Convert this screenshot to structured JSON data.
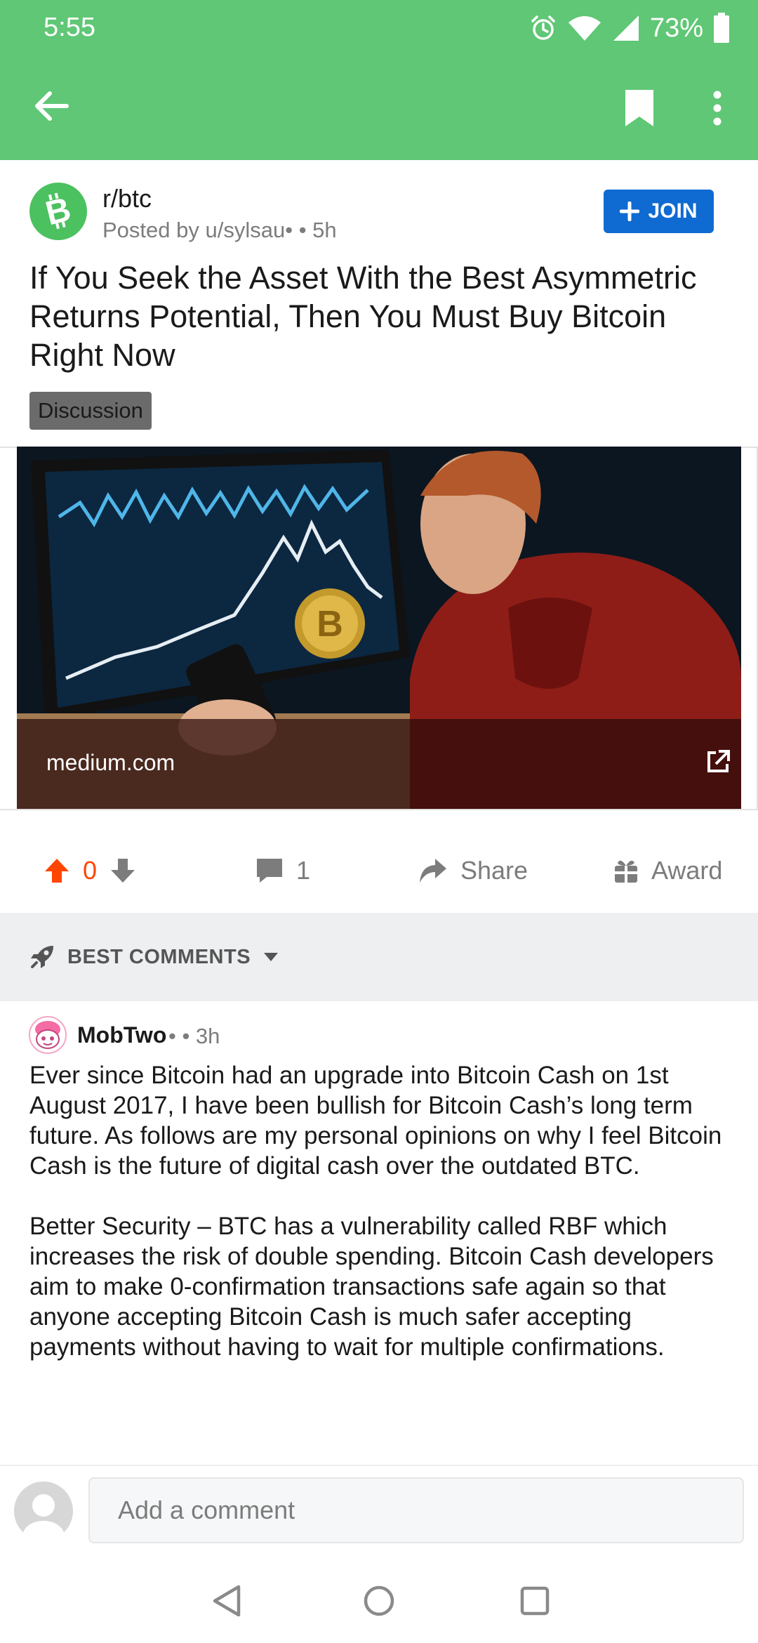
{
  "status_bar": {
    "time": "5:55",
    "battery": "73%",
    "icons": [
      "alarm-icon",
      "wifi-icon",
      "signal-icon",
      "battery-icon"
    ]
  },
  "app_bar": {
    "icons": [
      "back-arrow-icon",
      "bookmark-icon",
      "more-vertical-icon"
    ],
    "color": "#5fc775"
  },
  "post": {
    "subreddit": "r/btc",
    "posted_by": "Posted by u/sylsau•",
    "age": "• 5h",
    "join_label": "JOIN",
    "title": "If You Seek the Asset With the Best Asymmetric Returns Potential, Then You Must Buy Bitcoin Right Now",
    "flair": "Discussion",
    "link_domain": "medium.com",
    "upvotes": "0",
    "comments": "1",
    "share_label": "Share",
    "award_label": "Award"
  },
  "comments_section": {
    "sort_label": "BEST COMMENTS"
  },
  "comment": {
    "author": "MobTwo",
    "meta": "• • 3h",
    "paragraphs": [
      "Ever since Bitcoin had an upgrade into Bitcoin Cash on 1st August 2017, I have been bullish for Bitcoin Cash’s long term future. As follows are my personal opinions on why I feel Bitcoin Cash is the future of digital cash over the outdated BTC.",
      "Better Security – BTC has a vulnerability called RBF which increases the risk of double spending. Bitcoin Cash developers aim to make 0-confirmation transactions safe again so that anyone accepting Bitcoin Cash is much safer accepting payments without having to wait for multiple confirmations."
    ]
  },
  "composer": {
    "placeholder": "Add a comment"
  },
  "colors": {
    "accent_green": "#5fc775",
    "join_blue": "#0f6ad1",
    "upvote_orange": "#ff4500"
  }
}
